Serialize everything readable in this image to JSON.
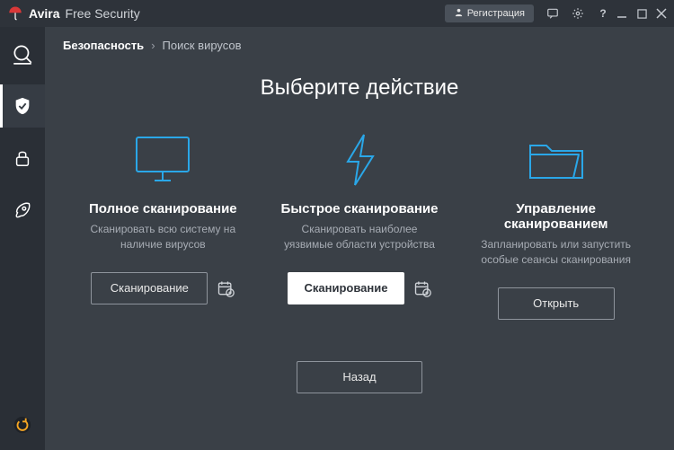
{
  "titlebar": {
    "brand": "Avira",
    "product": "Free Security",
    "register_label": "Регистрация"
  },
  "breadcrumb": {
    "root": "Безопасность",
    "current": "Поиск вирусов"
  },
  "page": {
    "title": "Выберите действие"
  },
  "cards": {
    "full": {
      "title": "Полное сканирование",
      "desc": "Сканировать всю систему на наличие вирусов",
      "button": "Сканирование"
    },
    "quick": {
      "title": "Быстрое сканирование",
      "desc": "Сканировать наиболее уязвимые области устройства",
      "button": "Сканирование"
    },
    "manage": {
      "title": "Управление сканированием",
      "desc": "Запланировать или запустить особые сеансы сканирования",
      "button": "Открыть"
    }
  },
  "back_button": "Назад"
}
